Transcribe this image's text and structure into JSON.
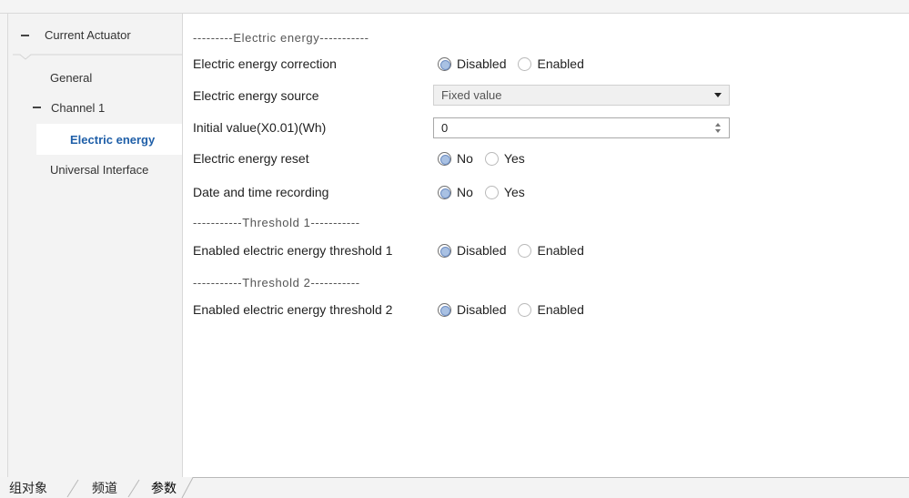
{
  "sidebar": {
    "header": {
      "toggle_icon": "collapse-icon",
      "label": "Current Actuator"
    },
    "items": [
      {
        "label": "General",
        "selected": false
      },
      {
        "toggle_icon": "collapse-icon",
        "label": "Channel 1",
        "selected": false
      },
      {
        "label": "Electric energy",
        "selected": true
      },
      {
        "label": "Universal Interface",
        "selected": false
      }
    ]
  },
  "main": {
    "separators": [
      "---------Electric energy-----------",
      "-----------Threshold 1-----------",
      "-----------Threshold 2-----------"
    ],
    "rows": [
      {
        "label": "Electric energy correction",
        "options": [
          "Disabled",
          "Enabled"
        ],
        "selected": 0
      },
      {
        "label": "Electric energy source",
        "value": "Fixed value",
        "icon": "chevron-down-icon"
      },
      {
        "label": "Initial value(X0.01)(Wh)",
        "value": "0",
        "icons": [
          "spinner-up-icon",
          "spinner-down-icon"
        ]
      },
      {
        "label": "Electric energy reset",
        "options": [
          "No",
          "Yes"
        ],
        "selected": 0
      },
      {
        "label": "Date and time recording",
        "options": [
          "No",
          "Yes"
        ],
        "selected": 0
      },
      {
        "label": "Enabled electric energy threshold 1",
        "options": [
          "Disabled",
          "Enabled"
        ],
        "selected": 0
      },
      {
        "label": "Enabled electric energy threshold 2",
        "options": [
          "Disabled",
          "Enabled"
        ],
        "selected": 0
      }
    ]
  },
  "bottom_tabs": {
    "items": [
      "组对象",
      "频道",
      "参数"
    ],
    "active": 2
  },
  "colors": {
    "selected_item_text": "#1f5fa8",
    "radio_dot": "#a9c1e3",
    "sidebar_bg": "#f3f3f3",
    "content_bg": "#ffffff"
  }
}
